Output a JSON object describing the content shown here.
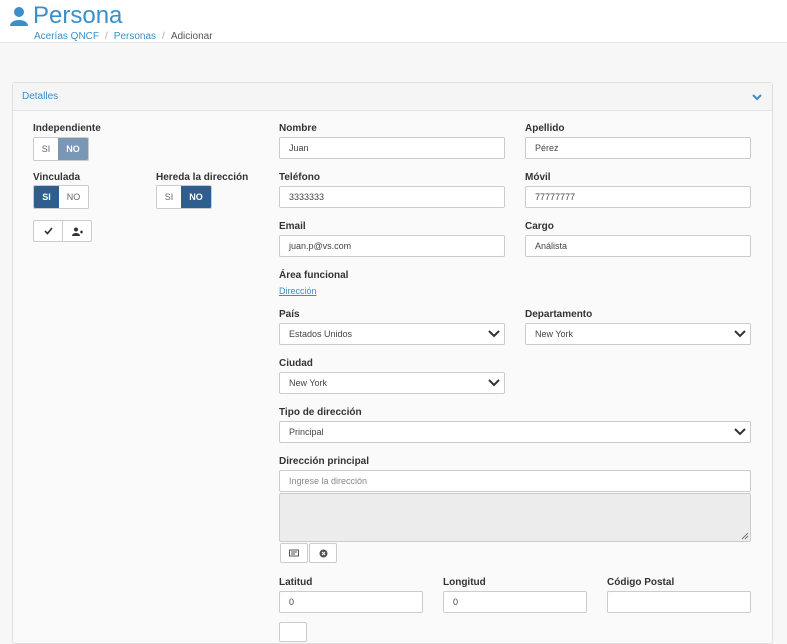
{
  "header": {
    "title": "Persona",
    "breadcrumb": [
      "Acerías QNCF",
      "Personas",
      "Adicionar"
    ],
    "separator": "/"
  },
  "panel": {
    "title": "Detalles"
  },
  "left": {
    "independiente": {
      "label": "Independiente",
      "si": "SI",
      "no": "NO",
      "selected": "NO"
    },
    "vinculada": {
      "label": "Vinculada",
      "si": "SI",
      "no": "NO",
      "selected": "SI"
    },
    "hereda": {
      "label": "Hereda la dirección",
      "si": "SI",
      "no": "NO",
      "selected": "NO"
    }
  },
  "form": {
    "nombre": {
      "label": "Nombre",
      "value": "Juan"
    },
    "apellido": {
      "label": "Apellido",
      "value": "Pérez"
    },
    "telefono": {
      "label": "Teléfono",
      "value": "3333333"
    },
    "movil": {
      "label": "Móvil",
      "value": "77777777"
    },
    "email": {
      "label": "Email",
      "value": "juan.p@vs.com"
    },
    "cargo": {
      "label": "Cargo",
      "value": "Análista"
    },
    "area": {
      "label": "Área funcional",
      "value": "Dirección"
    },
    "pais": {
      "label": "País",
      "value": "Estados Unidos"
    },
    "departamento": {
      "label": "Departamento",
      "value": "New York"
    },
    "ciudad": {
      "label": "Ciudad",
      "value": "New York"
    },
    "tipo_direccion": {
      "label": "Tipo de dirección",
      "value": "Principal"
    },
    "direccion": {
      "label": "Dirección principal",
      "placeholder": "Ingrese la dirección"
    },
    "latitud": {
      "label": "Latitud",
      "value": "0"
    },
    "longitud": {
      "label": "Longitud",
      "value": "0"
    },
    "codigo_postal": {
      "label": "Código Postal",
      "value": ""
    }
  },
  "colors": {
    "accent": "#3a8fc8",
    "toggle_on": "#2d5e8e"
  }
}
